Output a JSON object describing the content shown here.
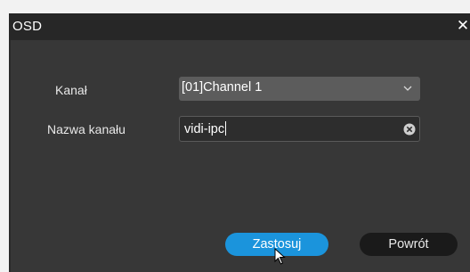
{
  "dialog": {
    "title": "OSD",
    "close_icon": "close-icon"
  },
  "form": {
    "channel_label": "Kanał",
    "channel_value": "[01]Channel 1",
    "name_label": "Nazwa kanału",
    "name_value": "vidi-ipc"
  },
  "buttons": {
    "apply_label": "Zastosuj",
    "back_label": "Powrót"
  },
  "colors": {
    "dialog_bg": "#373737",
    "titlebar_bg": "#272727",
    "apply_bg": "#1b94dc",
    "back_bg": "#1a1a1a",
    "select_bg": "#5c5c5c"
  },
  "icons": {
    "dropdown": "chevron-down-icon",
    "clear": "clear-input-icon",
    "pointer": "mouse-pointer-icon"
  }
}
